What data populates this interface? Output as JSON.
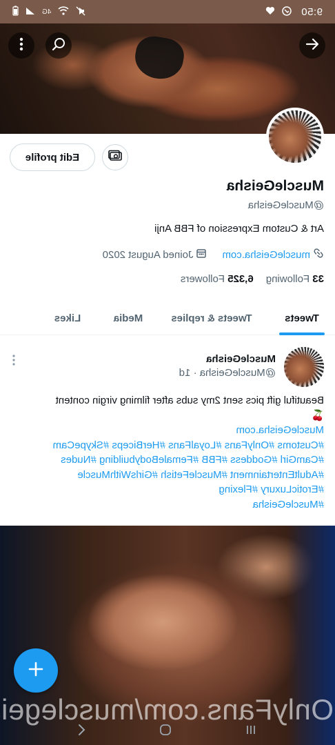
{
  "status_bar": {
    "time": "9:50",
    "network": "4G"
  },
  "profile": {
    "edit_profile_label": "Edit profile",
    "name": "MuscleGeisha",
    "handle": "@MuscleGeisha",
    "bio": "Art & Custom Expression of FBB Anji",
    "website": "muscleGeisha.com",
    "joined": "Joined August 2020",
    "following_count": "33",
    "following_label": "Following",
    "followers_count": "6,325",
    "followers_label": "Followers"
  },
  "tabs": [
    {
      "label": "Tweets",
      "active": true
    },
    {
      "label": "Tweets & replies",
      "active": false
    },
    {
      "label": "Media",
      "active": false
    },
    {
      "label": "Likes",
      "active": false
    }
  ],
  "tweet": {
    "name": "MuscleGeisha",
    "handle_time": "@MuscleGeisha · 1d",
    "text_line1": "Beautiful gift pics sent 2my subs after filming virgin content",
    "text_emoji": "🍒",
    "link": "MuscleGeisha.com",
    "hashtag_lines": [
      "#Customs #OnlyFans #LoyalFans #HerBiceps #SkypeCam",
      "#CamGirl #Goddess #FBB #FemaleBodybuilding #Nudes",
      "#AdultEntertainment #MuscleFetish #GirlsWithMuscle",
      "#EroticLuxury #Flexing",
      "#MuscleGeisha"
    ]
  },
  "media": {
    "watermark": "OnlyFans.com/musclegeisha"
  },
  "icons": {
    "menu": "more-vertical-icon",
    "search": "search-icon",
    "back": "arrow-icon",
    "receipt": "money-icon",
    "link": "link-icon",
    "calendar": "calendar-icon",
    "compose": "plus-icon"
  },
  "colors": {
    "accent": "#1d9bf0",
    "status_bar": "#7a5a4a",
    "secondary_text": "#536471"
  }
}
